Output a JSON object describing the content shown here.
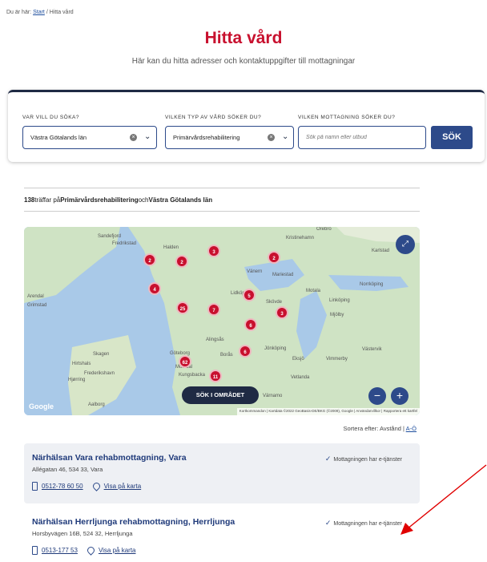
{
  "breadcrumb": {
    "prefix": "Du är här:",
    "home": "Start",
    "separator": " / ",
    "current": "Hitta vård"
  },
  "page": {
    "title": "Hitta vård",
    "subtitle": "Här kan du hitta adresser och kontaktuppgifter till mottagningar"
  },
  "search": {
    "region_label": "VAR VILL DU SÖKA?",
    "region_value": "Västra Götalands län",
    "care_label": "VILKEN TYP AV VÅRD SÖKER DU?",
    "care_value": "Primärvårdsrehabilitering",
    "clinic_label": "VILKEN MOTTAGNING SÖKER DU?",
    "clinic_placeholder": "Sök på namn eller utbud",
    "button": "SÖK"
  },
  "results_summary": {
    "count": "138",
    "text1": " träffar på ",
    "care": "Primärvårdsrehabilitering",
    "text2": " och ",
    "region": "Västra Götalands län"
  },
  "map": {
    "place_labels": [
      "Sandefjord",
      "Fredrikstad",
      "Halden",
      "Kristinehamn",
      "Örebro",
      "Karlstad",
      "Vänern",
      "Mariestad",
      "Lidköping",
      "Skövde",
      "Motala",
      "Linköping",
      "Norrköping",
      "Mjölby",
      "Jönköping",
      "Borås",
      "Alingsås",
      "Göteborg",
      "Mölndal",
      "Kungsbacka",
      "Skagen",
      "Hirtshals",
      "Hjørring",
      "Frederikshavn",
      "Aalborg",
      "Eksjö",
      "Vimmerby",
      "Vetlanda",
      "Värnamo",
      "Västervik",
      "Arendal",
      "Grimstad"
    ],
    "clusters": [
      "2",
      "2",
      "3",
      "2",
      "4",
      "5",
      "25",
      "7",
      "3",
      "6",
      "6",
      "62",
      "11"
    ],
    "search_area_button": "SÖK I OMRÅDET",
    "google": "Google",
    "attribution": "Kortkommandon | Kartdata ©2022 GeoBasis-DE/BKG (©2009), Google | Användarvillkor | Rapportera ett kartfel",
    "water_color": "#a9c9e8",
    "land_color": "#cfe3c4"
  },
  "sort": {
    "label": "Sortera efter:",
    "distance": "Avstånd",
    "separator": "|",
    "alpha": "A-Ö"
  },
  "results": [
    {
      "name": "Närhälsan Vara rehabmottagning, Vara",
      "address": "Allégatan 46, 534 33, Vara",
      "phone": "0512-78 60 50",
      "map_link": "Visa på karta",
      "eservice": "Mottagningen har e-tjänster"
    },
    {
      "name": "Närhälsan Herrljunga rehabmottagning, Herrljunga",
      "address": "Horsbyvägen 16B, 524 32, Herrljunga",
      "phone": "0513-177 53",
      "map_link": "Visa på karta",
      "eservice": "Mottagningen har e-tjänster"
    }
  ],
  "colors": {
    "brand_red": "#c8102e",
    "primary_blue": "#2d4a8a",
    "arrow_red": "#e00000"
  }
}
